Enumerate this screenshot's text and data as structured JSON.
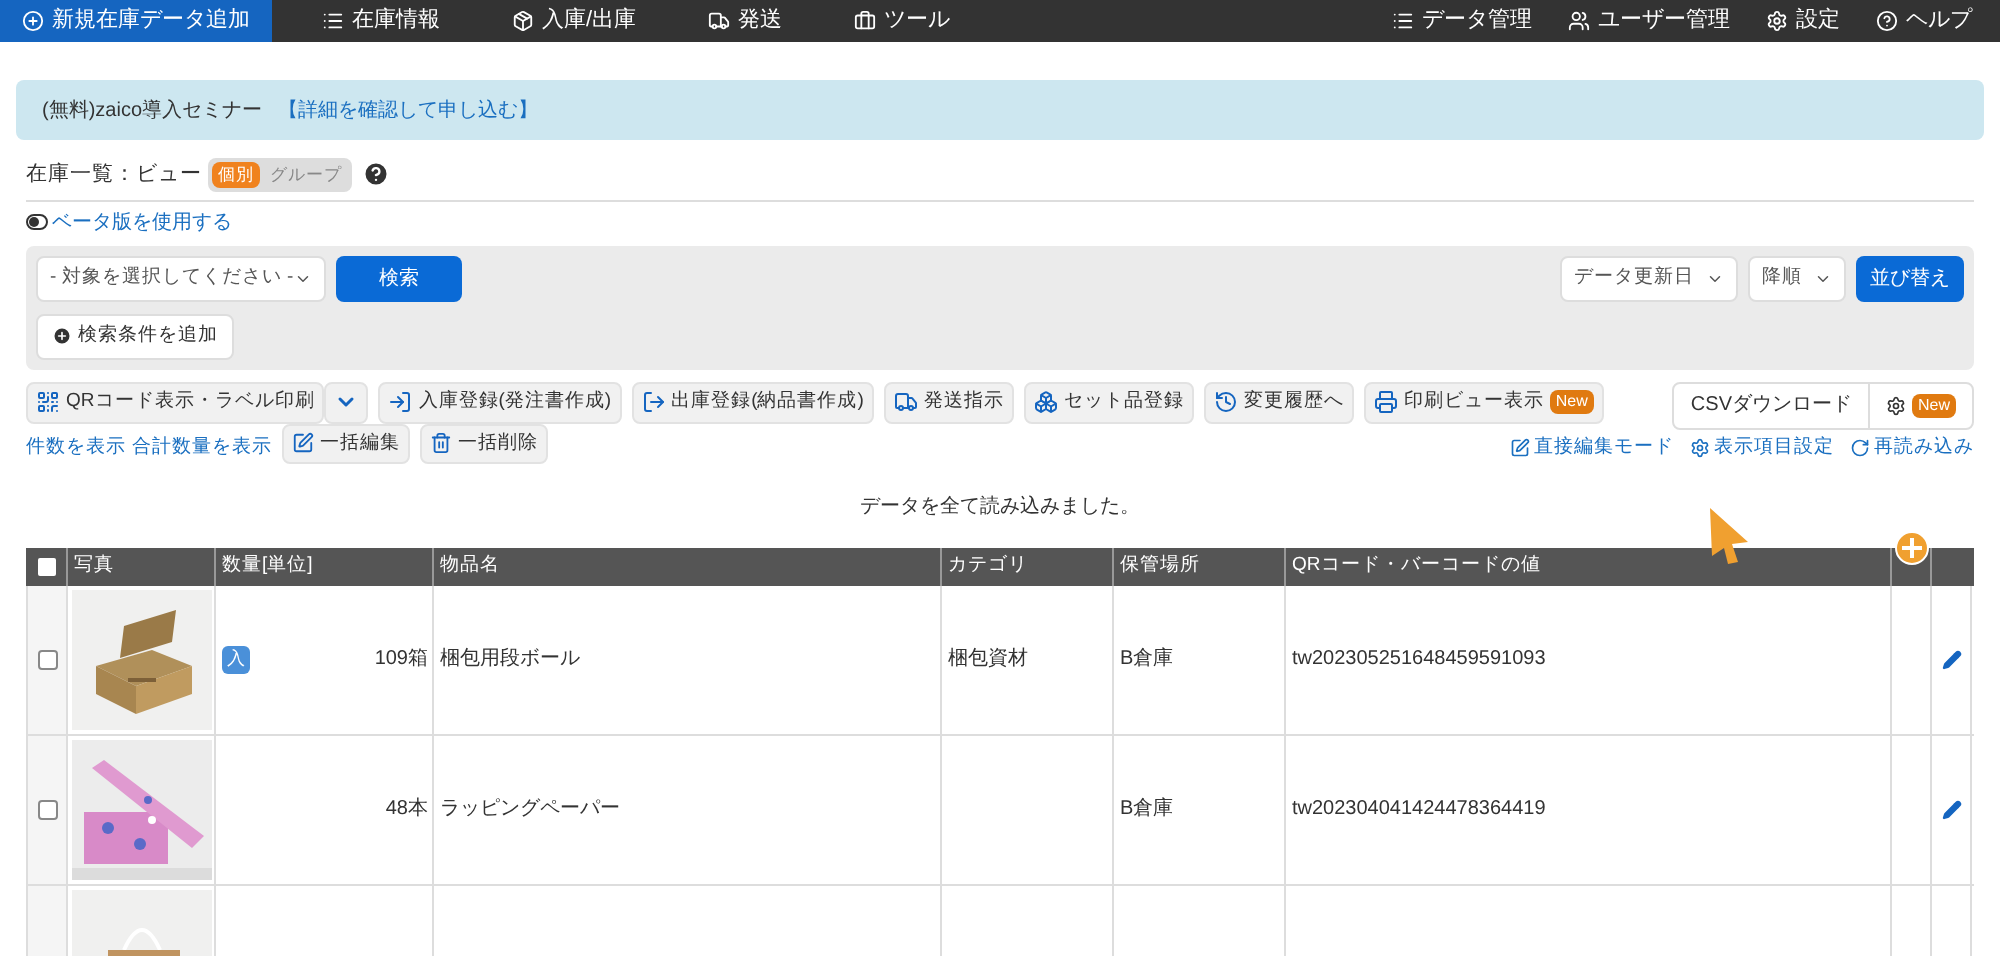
{
  "nav": {
    "left": [
      {
        "label": "新規在庫データ追加",
        "selected": true
      },
      {
        "label": "在庫情報",
        "selected": false
      },
      {
        "label": "入庫/出庫",
        "selected": false
      },
      {
        "label": "発送",
        "selected": false
      },
      {
        "label": "ツール",
        "selected": false
      }
    ],
    "right": [
      "データ管理",
      "ユーザー管理",
      "設定",
      "ヘルプ"
    ]
  },
  "banner": {
    "text": "(無料)zaico導入セミナー",
    "link": "【詳細を確認して申し込む】"
  },
  "view": {
    "label": "在庫一覧：ビュー",
    "options": [
      {
        "label": "個別",
        "selected": true
      },
      {
        "label": "グループ",
        "selected": false
      }
    ]
  },
  "beta_link": "ベータ版を使用する",
  "search": {
    "target_select": "- 対象を選択してください -",
    "search_button": "検索",
    "add_condition": "検索条件を追加",
    "sort_field": "データ更新日",
    "sort_order": "降順",
    "sort_button": "並び替え"
  },
  "actions": [
    {
      "label": "QRコード表示・ラベル印刷"
    },
    {
      "label": "入庫登録(発注書作成)"
    },
    {
      "label": "出庫登録(納品書作成)"
    },
    {
      "label": "発送指示"
    },
    {
      "label": "セット品登録"
    },
    {
      "label": "変更履歴へ"
    },
    {
      "label": "印刷ビュー表示",
      "badge": "New"
    }
  ],
  "csv": {
    "label": "CSVダウンロード",
    "settings_badge": "New"
  },
  "count_links": [
    "件数を表示",
    "合計数量を表示"
  ],
  "bulk": [
    "一括編集",
    "一括削除"
  ],
  "table_links": [
    "直接編集モード",
    "表示項目設定",
    "再読み込み"
  ],
  "status": "データを全て読み込みました。",
  "table": {
    "columns": [
      "写真",
      "数量[単位]",
      "物品名",
      "カテゴリ",
      "保管場所",
      "QRコード・バーコードの値"
    ],
    "select_all": false,
    "rows": [
      {
        "checked": false,
        "badge": "入",
        "quantity": "109箱",
        "name": "梱包用段ボール",
        "category": "梱包資材",
        "location": "B倉庫",
        "code": "tw202305251648459591093"
      },
      {
        "checked": false,
        "quantity": "48本",
        "name": "ラッピングペーパー",
        "location": "B倉庫",
        "code": "tw202304041424478364419"
      }
    ]
  }
}
